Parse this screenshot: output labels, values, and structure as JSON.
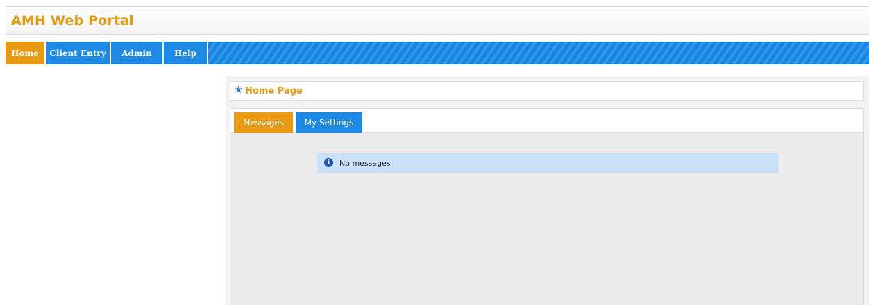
{
  "header": {
    "app_title": "AMH Web Portal"
  },
  "nav": {
    "items": [
      {
        "label": "Home",
        "active": true
      },
      {
        "label": "Client Entry",
        "active": false
      },
      {
        "label": "Admin",
        "active": false
      },
      {
        "label": "Help",
        "active": false
      }
    ]
  },
  "main": {
    "page_title": "Home Page",
    "title_icon": "star-icon",
    "tabs": [
      {
        "label": "Messages",
        "active": true
      },
      {
        "label": "My Settings",
        "active": false
      }
    ],
    "message": {
      "icon": "info-icon",
      "text": "No messages"
    }
  },
  "colors": {
    "accent_orange": "#e99a12",
    "nav_blue": "#1e88e5",
    "message_bg": "#c9e1f9"
  }
}
